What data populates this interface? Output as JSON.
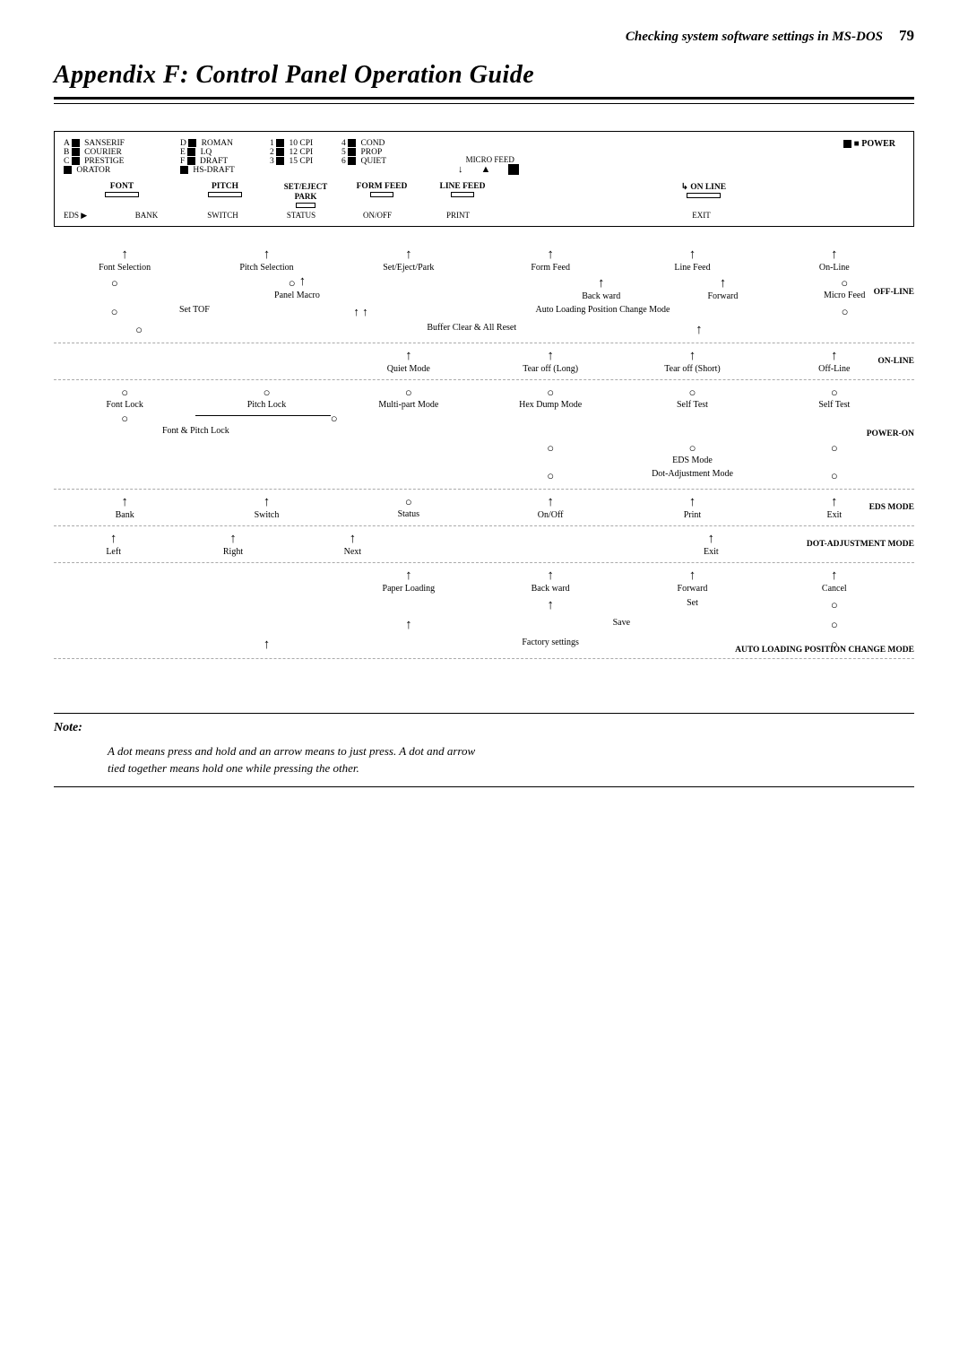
{
  "header": {
    "title": "Checking system software settings in MS-DOS",
    "page_num": "79"
  },
  "appendix": {
    "title": "Appendix F:  Control Panel Operation Guide"
  },
  "panel": {
    "fonts": [
      "A ■ SANSERIF",
      "B ■ COURIER",
      "C ■ PRESTIGE",
      "■ ORATOR"
    ],
    "fonts_right": [
      "D ■ ROMAN",
      "E ■ LQ",
      "F ■ DRAFT",
      "■ HS-DRAFT"
    ],
    "pitches": [
      "1 ■ 10 CPI",
      "2 ■ 12 CPI",
      "3 ■ 15 CPI"
    ],
    "pitches_right": [
      "4 ■ COND",
      "5 ■ PROP",
      "6 ■ QUIET"
    ],
    "buttons": [
      {
        "top": "FONT",
        "label": "BANK"
      },
      {
        "top": "PITCH",
        "label": "SWITCH"
      },
      {
        "top": "SET/EJECT\nPARK",
        "label": "STATUS"
      },
      {
        "top": "FORM FEED",
        "label": "ON/OFF"
      },
      {
        "top": "LINE FEED",
        "label": "PRINT"
      },
      {
        "top": "→ ON LINE",
        "label": "EXIT"
      }
    ],
    "power_label": "■ POWER",
    "micro_feed": "MICRO FEED"
  },
  "normal_mode": {
    "cols": [
      {
        "sym": "↑",
        "label": "Font Selection"
      },
      {
        "sym": "↑",
        "label": "Pitch Selection"
      },
      {
        "sym": "↑",
        "label": "Set/Eject/Park"
      },
      {
        "sym": "↑",
        "label": "Form Feed"
      },
      {
        "sym": "↑",
        "label": "Line Feed"
      },
      {
        "sym": "↑",
        "label": "On-Line"
      }
    ],
    "row2": [
      {
        "sym": "○",
        "label": ""
      },
      {
        "sym": "↑",
        "label": "Panel Macro"
      },
      {
        "sym": "",
        "label": ""
      },
      {
        "sym": "↑",
        "label": "Back ward"
      },
      {
        "sym": "↑",
        "label": "Forward"
      },
      {
        "sym": "○",
        "label": "Micro Feed"
      }
    ],
    "row3": [
      {
        "sym": "○",
        "label": ""
      },
      {
        "sym": "",
        "label": "Set TOF"
      },
      {
        "sym": "↑ ↑",
        "label": ""
      },
      {
        "sym": "",
        "label": "Auto Loading Position Change Mode"
      },
      {
        "sym": "",
        "label": ""
      },
      {
        "sym": "○",
        "label": ""
      }
    ],
    "row4": [
      {
        "sym": "○",
        "label": ""
      },
      {
        "sym": "",
        "label": "Buffer Clear & All Reset"
      },
      {
        "sym": "↑",
        "label": ""
      }
    ]
  },
  "offline_mode": {
    "label": "OFF-LINE",
    "cols": [
      {
        "sym": "",
        "label": ""
      },
      {
        "sym": "",
        "label": ""
      },
      {
        "sym": "↑",
        "label": "Quiet Mode"
      },
      {
        "sym": "↑",
        "label": "Tear off (Long)"
      },
      {
        "sym": "↑",
        "label": "Tear off (Short)"
      },
      {
        "sym": "↑",
        "label": "Off-Line"
      }
    ]
  },
  "online_mode": {
    "label": "ON-LINE",
    "cols": [
      {
        "sym": "○",
        "label": "Font Lock"
      },
      {
        "sym": "○",
        "label": "Pitch Lock"
      },
      {
        "sym": "○",
        "label": "Multi-part Mode"
      },
      {
        "sym": "○",
        "label": "Hex Dump Mode"
      },
      {
        "sym": "○",
        "label": "Self Test"
      },
      {
        "sym": "○",
        "label": "Self Test"
      }
    ],
    "row2_label": "Font & Pitch Lock",
    "row3": [
      {
        "sym": "○",
        "label": ""
      },
      {
        "sym": "",
        "label": "EDS Mode"
      },
      {
        "sym": "○",
        "label": ""
      }
    ],
    "row4": [
      {
        "sym": "○",
        "label": ""
      },
      {
        "sym": "",
        "label": "Dot-Adjustment Mode"
      },
      {
        "sym": "○",
        "label": ""
      }
    ]
  },
  "poweron_mode": {
    "label": "POWER-ON",
    "cols": [
      {
        "sym": "↑",
        "label": "Bank"
      },
      {
        "sym": "↑",
        "label": "Switch"
      },
      {
        "sym": "○",
        "label": "Status"
      },
      {
        "sym": "↑",
        "label": "On/Off"
      },
      {
        "sym": "↑",
        "label": "Print"
      },
      {
        "sym": "↑",
        "label": "Exit"
      }
    ]
  },
  "edsmode": {
    "label": "EDS MODE",
    "cols": [
      {
        "sym": "↑",
        "label": "Left"
      },
      {
        "sym": "↑",
        "label": "Right"
      },
      {
        "sym": "↑",
        "label": "Next"
      },
      {
        "sym": "",
        "label": ""
      },
      {
        "sym": "",
        "label": ""
      },
      {
        "sym": "↑",
        "label": "Exit"
      }
    ]
  },
  "dotadj_mode": {
    "label": "DOT-ADJUSTMENT MODE",
    "cols": [
      {
        "sym": "",
        "label": ""
      },
      {
        "sym": "",
        "label": ""
      },
      {
        "sym": "↑",
        "label": "Paper Loading"
      },
      {
        "sym": "↑",
        "label": "Back ward"
      },
      {
        "sym": "↑",
        "label": "Forward"
      },
      {
        "sym": "↑",
        "label": "Cancel"
      }
    ],
    "row2": [
      {
        "sym": "",
        "label": ""
      },
      {
        "sym": "",
        "label": ""
      },
      {
        "sym": "",
        "label": ""
      },
      {
        "sym": "↑",
        "label": ""
      },
      {
        "sym": "",
        "label": "Set"
      },
      {
        "sym": "○",
        "label": ""
      }
    ],
    "row3": [
      {
        "sym": "",
        "label": ""
      },
      {
        "sym": "",
        "label": ""
      },
      {
        "sym": "↑",
        "label": ""
      },
      {
        "sym": "",
        "label": "Save"
      },
      {
        "sym": "",
        "label": ""
      },
      {
        "sym": "○",
        "label": ""
      }
    ],
    "row4": [
      {
        "sym": "",
        "label": ""
      },
      {
        "sym": "",
        "label": ""
      },
      {
        "sym": "↑",
        "label": ""
      },
      {
        "sym": "",
        "label": "Factory settings"
      },
      {
        "sym": "",
        "label": ""
      },
      {
        "sym": "○",
        "label": ""
      }
    ]
  },
  "autoload_mode": {
    "label": "AUTO LOADING POSITION CHANGE MODE"
  },
  "note": {
    "title": "Note:",
    "text": "A dot means press and hold and an arrow means to just press. A dot and arrow\ntied together means hold one while pressing the other."
  }
}
